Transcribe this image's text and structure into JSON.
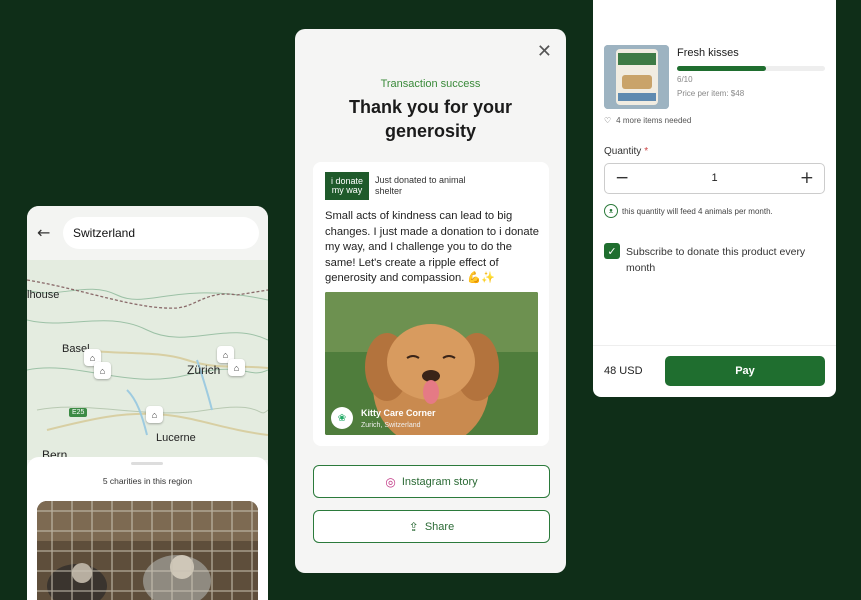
{
  "map_card": {
    "search_value": "Switzerland",
    "cities": [
      "lhouse",
      "Basel",
      "Zürich",
      "Bern",
      "Lucerne"
    ],
    "road_label": "E25",
    "charities_count": "5 charities in this region"
  },
  "thanks_card": {
    "status": "Transaction success",
    "title": "Thank you for your generosity",
    "post": {
      "logo_text": "i donate my way",
      "header": "Just donated to animal shelter",
      "message": "Small acts of kindness can lead to big changes. I just made a donation to i donate my way, and I challenge you to do the same! Let's create a ripple effect of generosity and compassion. 💪✨",
      "org_name": "Kitty Care Corner",
      "org_location": "Zurich, Switzerland"
    },
    "instagram_label": "Instagram story",
    "share_label": "Share"
  },
  "product_card": {
    "product_name": "Fresh kisses",
    "progress_text": "6/10",
    "progress_fraction": 0.6,
    "price_per_item": "Price per item: $48",
    "more_needed": "4 more items needed",
    "quantity_label": "Quantity",
    "required_mark": "*",
    "quantity_value": "1",
    "feed_note": "this quantity will feed 4 animals per month.",
    "subscribe_label": "Subscribe to donate this product every month",
    "subscribed": true,
    "total": "48 USD",
    "pay_label": "Pay"
  },
  "colors": {
    "background": "#0f2e18",
    "brand_green": "#1f6e2f",
    "success_green": "#3a8a3a"
  }
}
